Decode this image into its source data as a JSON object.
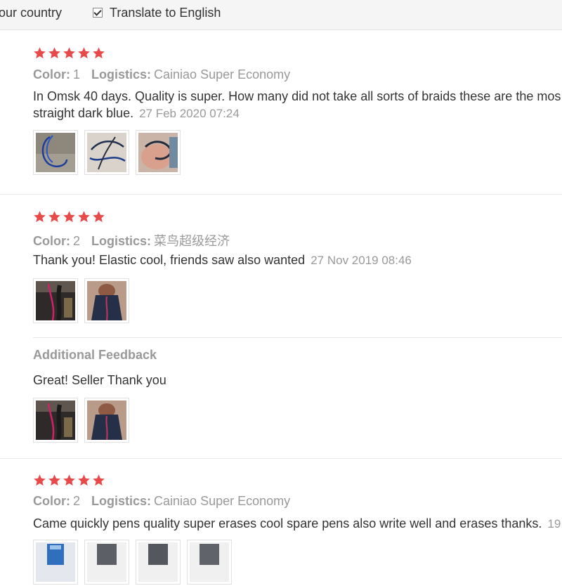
{
  "topbar": {
    "country_text": "our country",
    "translate_checkbox_checked": true,
    "translate_label": "Translate to English"
  },
  "labels": {
    "color": "Color:",
    "logistics": "Logistics:",
    "additional_feedback": "Additional Feedback"
  },
  "colors": {
    "star": "#e84a4a",
    "muted": "#999999",
    "text": "#333333"
  },
  "reviews": [
    {
      "rating": 5,
      "color_value": "1",
      "logistics_value": "Cainiao Super Economy",
      "text_line1": "In Omsk 40 days. Quality is super. How many did not take all sorts of braids these are the mos",
      "text_line2": "straight dark blue.",
      "date": "27 Feb 2020 07:24",
      "photos": [
        "photo-blue-braid-coil",
        "photo-blue-braid-loops",
        "photo-braid-on-hand"
      ]
    },
    {
      "rating": 5,
      "color_value": "2",
      "logistics_value": "菜鸟超级经济",
      "text": "Thank you! Elastic cool, friends saw also wanted",
      "date": "27 Nov 2019 08:46",
      "photos": [
        "photo-braid-on-hair",
        "photo-braid-back-view"
      ],
      "additional_feedback": {
        "text": "Great! Seller Thank you",
        "photos": [
          "photo-braid-on-hair",
          "photo-braid-back-view"
        ]
      }
    },
    {
      "rating": 5,
      "color_value": "2",
      "logistics_value": "Cainiao Super Economy",
      "text": "Came quickly pens quality super erases cool spare pens also write well and erases thanks.",
      "date": "19",
      "photos": [
        "photo-pens-1",
        "photo-pens-2",
        "photo-pens-3",
        "photo-pens-4"
      ]
    }
  ]
}
